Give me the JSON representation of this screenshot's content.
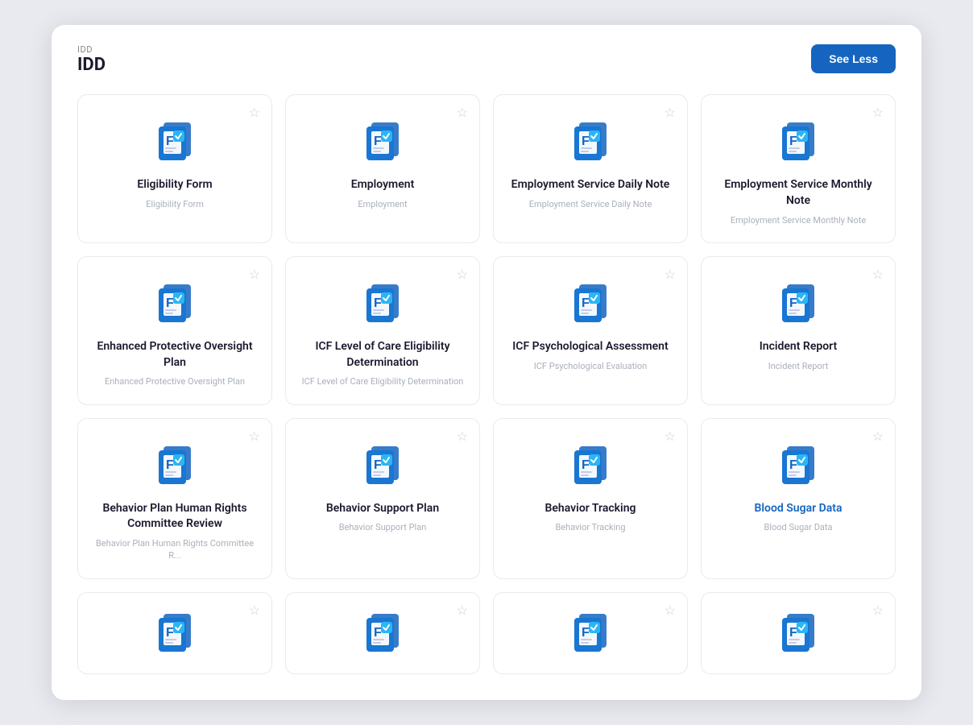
{
  "header": {
    "label": "IDD",
    "title": "IDD",
    "see_less": "See Less"
  },
  "cards": [
    {
      "id": "eligibility-form",
      "title": "Eligibility Form",
      "subtitle": "Eligibility Form",
      "blue": false
    },
    {
      "id": "employment",
      "title": "Employment",
      "subtitle": "Employment",
      "blue": false
    },
    {
      "id": "employment-service-daily-note",
      "title": "Employment Service Daily Note",
      "subtitle": "Employment Service Daily Note",
      "blue": false
    },
    {
      "id": "employment-service-monthly-note",
      "title": "Employment Service Monthly Note",
      "subtitle": "Employment Service Monthly Note",
      "blue": false
    },
    {
      "id": "enhanced-protective-oversight-plan",
      "title": "Enhanced Protective Oversight Plan",
      "subtitle": "Enhanced Protective Oversight Plan",
      "blue": false
    },
    {
      "id": "icf-level-of-care-eligibility-determination",
      "title": "ICF Level of Care Eligibility Determination",
      "subtitle": "ICF Level of Care Eligibility Determination",
      "blue": false
    },
    {
      "id": "icf-psychological-assessment",
      "title": "ICF Psychological Assessment",
      "subtitle": "ICF Psychological Evaluation",
      "blue": false
    },
    {
      "id": "incident-report",
      "title": "Incident Report",
      "subtitle": "Incident Report",
      "blue": false
    },
    {
      "id": "behavior-plan-human-rights",
      "title": "Behavior Plan Human Rights Committee Review",
      "subtitle": "Behavior Plan Human Rights Committee R...",
      "blue": false
    },
    {
      "id": "behavior-support-plan",
      "title": "Behavior Support Plan",
      "subtitle": "Behavior Support Plan",
      "blue": false
    },
    {
      "id": "behavior-tracking",
      "title": "Behavior Tracking",
      "subtitle": "Behavior Tracking",
      "blue": false
    },
    {
      "id": "blood-sugar-data",
      "title": "Blood Sugar Data",
      "subtitle": "Blood Sugar Data",
      "blue": true
    },
    {
      "id": "partial-1",
      "title": "",
      "subtitle": "",
      "blue": false,
      "partial": true
    },
    {
      "id": "partial-2",
      "title": "",
      "subtitle": "",
      "blue": false,
      "partial": true
    },
    {
      "id": "partial-3",
      "title": "",
      "subtitle": "",
      "blue": false,
      "partial": true
    },
    {
      "id": "partial-4",
      "title": "",
      "subtitle": "",
      "blue": false,
      "partial": true
    }
  ]
}
